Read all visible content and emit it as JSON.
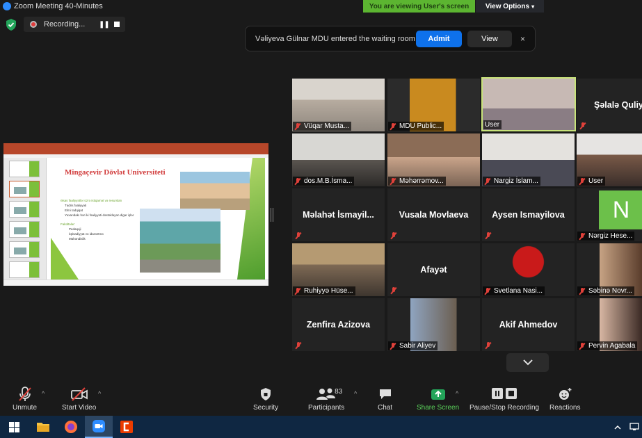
{
  "window": {
    "title": "Zoom Meeting 40-Minutes"
  },
  "banner": {
    "viewing_text": "You are viewing User's screen",
    "view_options_label": "View Options"
  },
  "recording": {
    "label": "Recording..."
  },
  "notification": {
    "message": "Vəliyeva Gülnar MDU entered the waiting room",
    "admit_label": "Admit",
    "view_label": "View",
    "close_glyph": "×"
  },
  "shared_screen": {
    "slide_title": "Mingaçevir Dövlət Universiteti",
    "bullets_heading": "Əsas fəaliyyətlər üzrə istiqamət və resursları",
    "bullets": [
      "Tədris fəaliyyəti",
      "Elmi tədqiqat",
      "Yuxarıdakı hər iki fəaliyyəti dəstəkləyən digər işlər"
    ],
    "sub_heading": "Fakültələr:",
    "sub_bullets": [
      "Pedaqoji",
      "İqtisadiyyat və idarəetmə",
      "Mühəndislik"
    ]
  },
  "participants": [
    {
      "name": "Vüqar Musta...",
      "video": true
    },
    {
      "name": "MDU Public...",
      "video": true
    },
    {
      "name": "User",
      "video": true,
      "active_speaker": true
    },
    {
      "name": "Şəlalə Quliyeva",
      "video": false
    },
    {
      "name": "dos.M.B.İsma...",
      "video": true
    },
    {
      "name": "Məhərrəmov...",
      "video": true
    },
    {
      "name": "Nargiz İslam...",
      "video": true
    },
    {
      "name": "User",
      "video": true
    },
    {
      "name": "Məlahət  İsmayil...",
      "video": false
    },
    {
      "name": "Vusala Movlaeva",
      "video": false
    },
    {
      "name": "Aysen Ismayilova",
      "video": false
    },
    {
      "name": "Nərgiz Hese...",
      "video": false,
      "avatar_letter": "N"
    },
    {
      "name": "Ruhiyyə Hüse...",
      "video": true
    },
    {
      "name": "Afayət",
      "video": false
    },
    {
      "name": "Svetlana Nasi...",
      "video": true
    },
    {
      "name": "Səbinə Novr...",
      "video": true
    },
    {
      "name": "Zenfira Azizova",
      "video": false
    },
    {
      "name": "Sabir Aliyev",
      "video": true
    },
    {
      "name": "Akif Ahmedov",
      "video": false
    },
    {
      "name": "Pervin Agabala",
      "video": true
    }
  ],
  "toolbar": {
    "unmute": "Unmute",
    "start_video": "Start Video",
    "security": "Security",
    "participants": "Participants",
    "participants_count": "83",
    "chat": "Chat",
    "share_screen": "Share Screen",
    "pause_stop_recording": "Pause/Stop Recording",
    "reactions": "Reactions"
  },
  "colors": {
    "accent": "#0e71eb",
    "banner_green": "#5cb531",
    "share_green": "#5bd35b",
    "mute_red": "#e0413a",
    "taskbar": "#0f2742"
  },
  "taskbar": {
    "icons": [
      "windows-start-icon",
      "file-explorer-icon",
      "firefox-icon",
      "zoom-icon",
      "office-icon"
    ]
  }
}
